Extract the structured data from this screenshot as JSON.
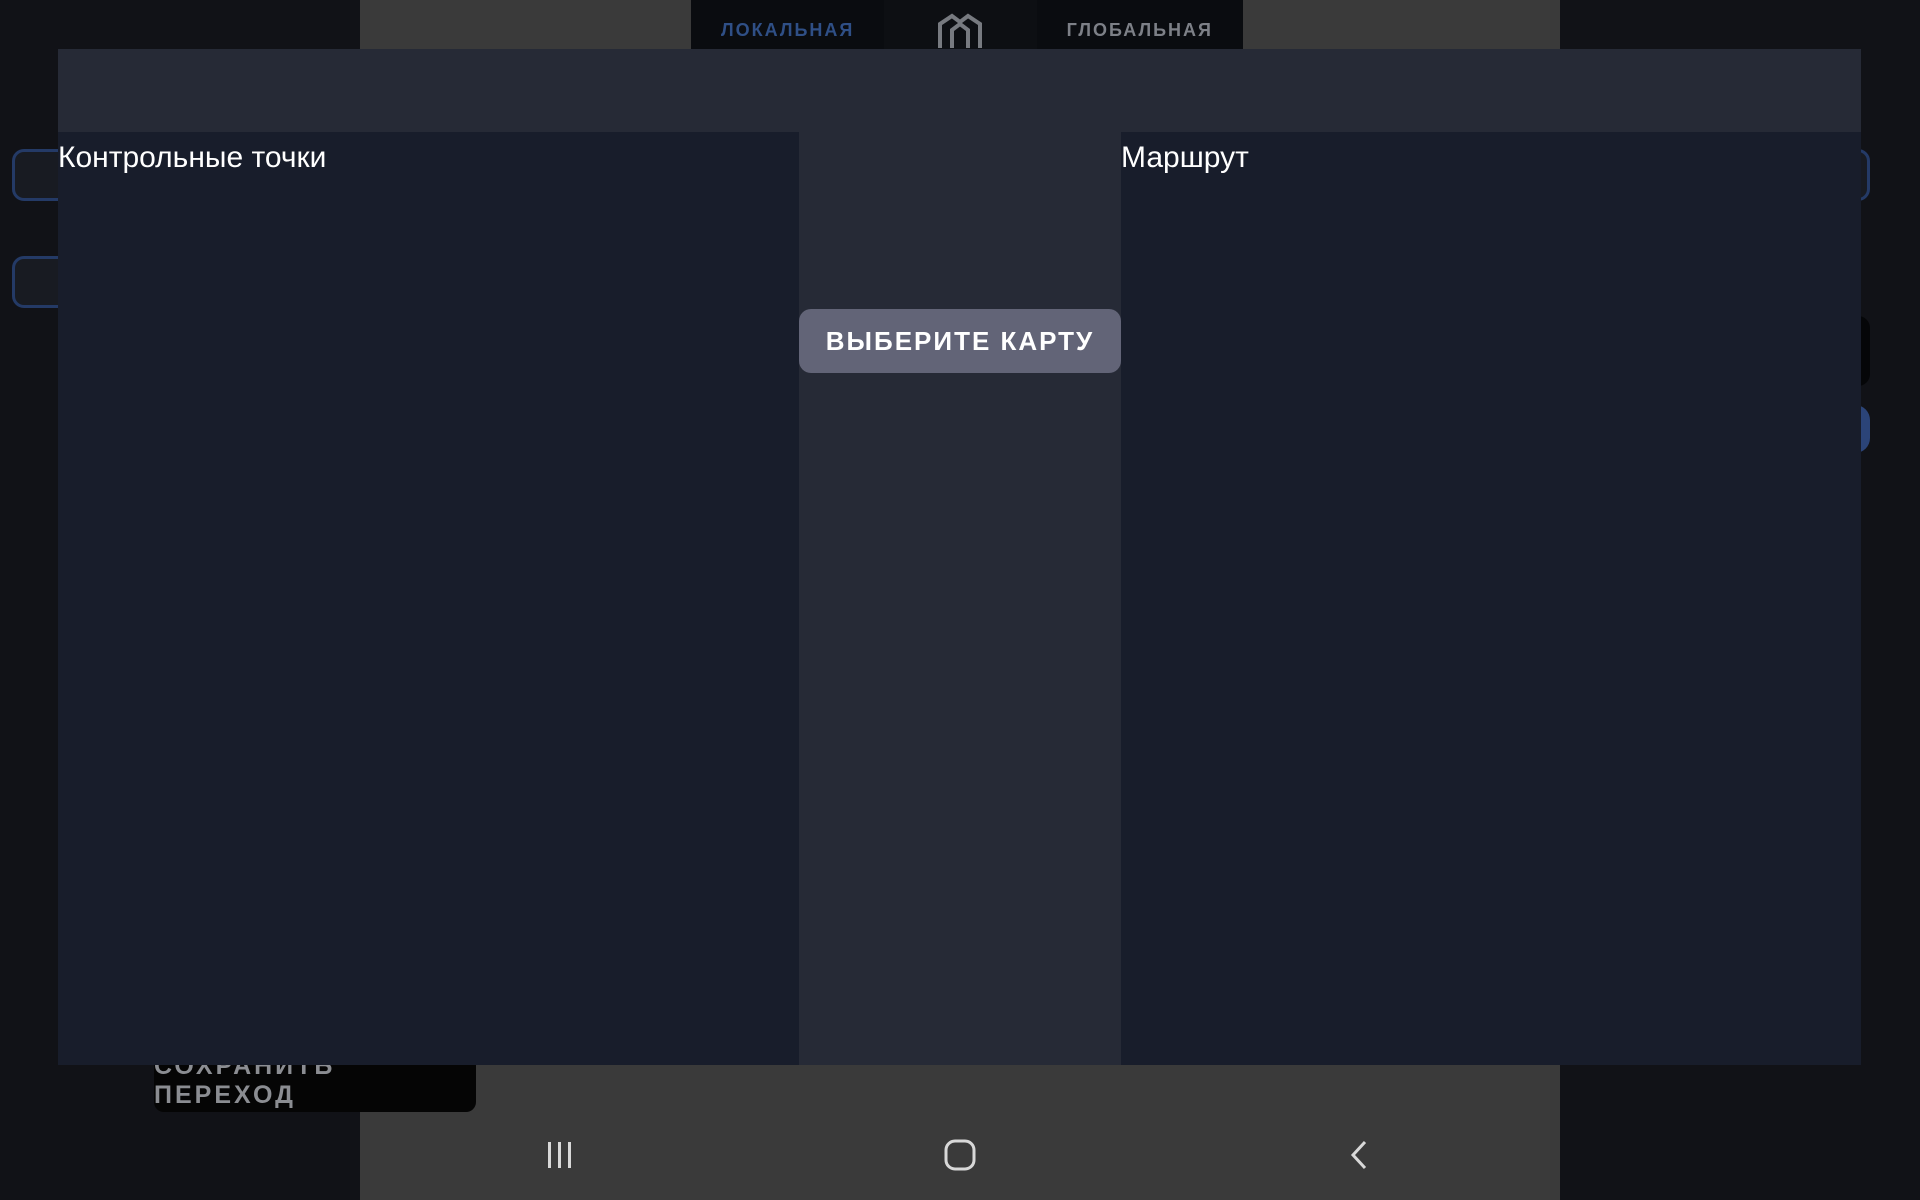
{
  "background": {
    "tab_local": "ЛОКАЛЬНАЯ",
    "tab_global": "ГЛОБАЛЬНАЯ",
    "save_transition_label": "СОХРАНИТЬ ПЕРЕХОД"
  },
  "dialog": {
    "waypoints_title": "Контрольные точки",
    "route_title": "Маршрут",
    "select_map_label": "ВЫБЕРИТЕ КАРТУ"
  },
  "navbar": {
    "recents_icon": "recents-icon",
    "home_icon": "home-icon",
    "back_icon": "back-icon"
  },
  "colors": {
    "dialog_bg": "#262a36",
    "panel_bg": "#181d2b",
    "button_bg": "#626477",
    "accent_blue": "#2f4f86"
  }
}
